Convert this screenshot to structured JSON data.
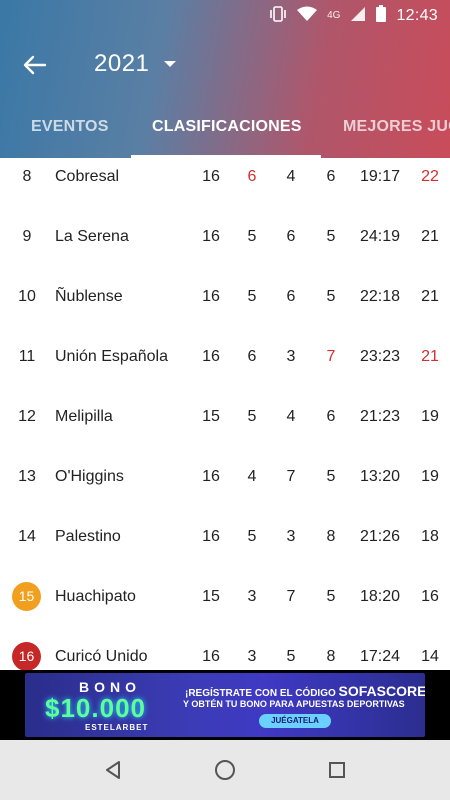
{
  "status_bar": {
    "time": "12:43",
    "network": "4G"
  },
  "toolbar": {
    "season": "2021"
  },
  "tabs": [
    {
      "label": "EVENTOS"
    },
    {
      "label": "CLASIFICACIONES"
    },
    {
      "label": "MEJORES JUG"
    }
  ],
  "standings": [
    {
      "pos": "8",
      "team": "Cobresal",
      "pj": "16",
      "pg": "6",
      "pe": "4",
      "pp": "6",
      "goals": "19:17",
      "pts": "22",
      "pg_red": true,
      "pp_red": false,
      "pts_red": true
    },
    {
      "pos": "9",
      "team": "La Serena",
      "pj": "16",
      "pg": "5",
      "pe": "6",
      "pp": "5",
      "goals": "24:19",
      "pts": "21",
      "pg_red": false,
      "pp_red": false,
      "pts_red": false
    },
    {
      "pos": "10",
      "team": "Ñublense",
      "pj": "16",
      "pg": "5",
      "pe": "6",
      "pp": "5",
      "goals": "22:18",
      "pts": "21",
      "pg_red": false,
      "pp_red": false,
      "pts_red": false
    },
    {
      "pos": "11",
      "team": "Unión Española",
      "pj": "16",
      "pg": "6",
      "pe": "3",
      "pp": "7",
      "goals": "23:23",
      "pts": "21",
      "pg_red": false,
      "pp_red": true,
      "pts_red": true
    },
    {
      "pos": "12",
      "team": "Melipilla",
      "pj": "15",
      "pg": "5",
      "pe": "4",
      "pp": "6",
      "goals": "21:23",
      "pts": "19",
      "pg_red": false,
      "pp_red": false,
      "pts_red": false
    },
    {
      "pos": "13",
      "team": "O'Higgins",
      "pj": "16",
      "pg": "4",
      "pe": "7",
      "pp": "5",
      "goals": "13:20",
      "pts": "19",
      "pg_red": false,
      "pp_red": false,
      "pts_red": false
    },
    {
      "pos": "14",
      "team": "Palestino",
      "pj": "16",
      "pg": "5",
      "pe": "3",
      "pp": "8",
      "goals": "21:26",
      "pts": "18",
      "pg_red": false,
      "pp_red": false,
      "pts_red": false
    },
    {
      "pos": "15",
      "team": "Huachipato",
      "pj": "15",
      "pg": "3",
      "pe": "7",
      "pp": "5",
      "goals": "18:20",
      "pts": "16",
      "pg_red": false,
      "pp_red": false,
      "pts_red": false,
      "badge": "#f0a01e"
    },
    {
      "pos": "16",
      "team": "Curicó Unido",
      "pj": "16",
      "pg": "3",
      "pe": "5",
      "pp": "8",
      "goals": "17:24",
      "pts": "14",
      "pg_red": false,
      "pp_red": false,
      "pts_red": false,
      "badge": "#c62828"
    }
  ],
  "ad": {
    "bono": "BONO",
    "amount": "$10.000",
    "brand": "ESTELARBET",
    "line1": "¡REGÍSTRATE CON EL CÓDIGO",
    "code": "SOFASCORE",
    "line2": "Y OBTÉN TU BONO PARA APUESTAS DEPORTIVAS",
    "cta": "JUÉGATELA"
  },
  "colors": {
    "accent_red": "#d32f2f",
    "relegation_orange": "#f0a01e",
    "relegation_red": "#c62828"
  }
}
